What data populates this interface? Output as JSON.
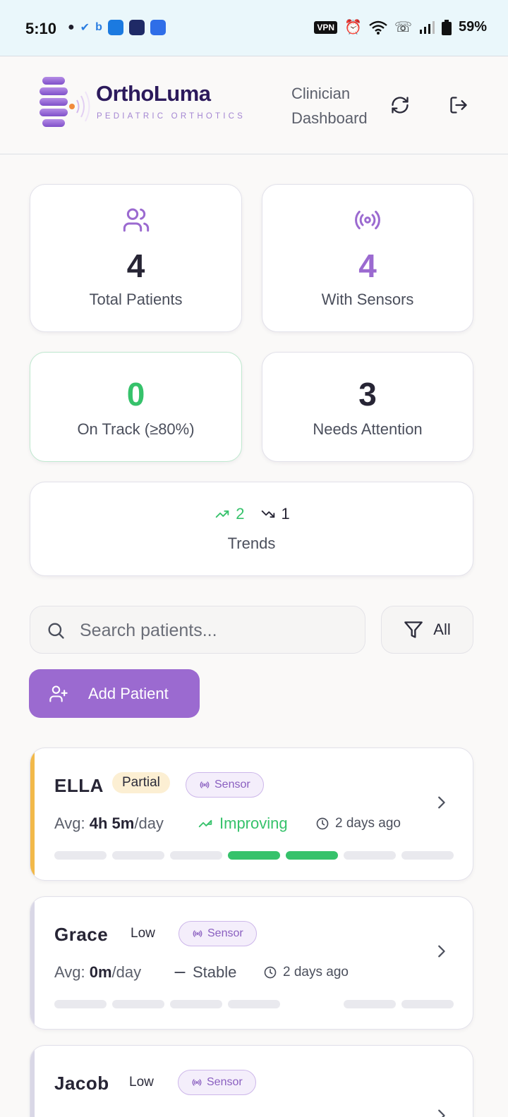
{
  "status_bar": {
    "time": "5:10",
    "vpn": "VPN",
    "battery": "59%"
  },
  "header": {
    "app_name": "OrthoLuma",
    "tagline": "PEDIATRIC ORTHOTICS",
    "view_title": "Clinician Dashboard"
  },
  "stats": {
    "total_patients": {
      "value": "4",
      "label": "Total Patients"
    },
    "with_sensors": {
      "value": "4",
      "label": "With Sensors"
    },
    "on_track": {
      "value": "0",
      "label": "On Track (≥80%)"
    },
    "needs_attention": {
      "value": "3",
      "label": "Needs Attention"
    },
    "trends": {
      "up": "2",
      "down": "1",
      "label": "Trends"
    }
  },
  "search": {
    "placeholder": "Search patients..."
  },
  "filter": {
    "label": "All"
  },
  "add_patient": {
    "label": "Add Patient"
  },
  "patients": [
    {
      "name": "ELLA",
      "level": "Partial",
      "sensor": "Sensor",
      "avg_prefix": "Avg: ",
      "avg_value": "4h 5m",
      "avg_suffix": "/day",
      "trend": "Improving",
      "last_seen": "2 days ago",
      "accent": "#f2b94a",
      "week_bars": [
        0,
        0,
        0,
        1,
        1,
        0,
        0
      ]
    },
    {
      "name": "Grace",
      "level": "Low",
      "sensor": "Sensor",
      "avg_prefix": "Avg: ",
      "avg_value": "0m",
      "avg_suffix": "/day",
      "trend": "Stable",
      "last_seen": "2 days ago",
      "accent": "#d9d7e6",
      "week_bars": [
        0,
        0,
        0,
        0,
        null,
        0,
        0
      ]
    },
    {
      "name": "Jacob",
      "level": "Low",
      "sensor": "Sensor"
    }
  ],
  "colors": {
    "brand": "#9b6ad0",
    "brand_dark": "#2c1a5c",
    "good": "#36c26b"
  }
}
